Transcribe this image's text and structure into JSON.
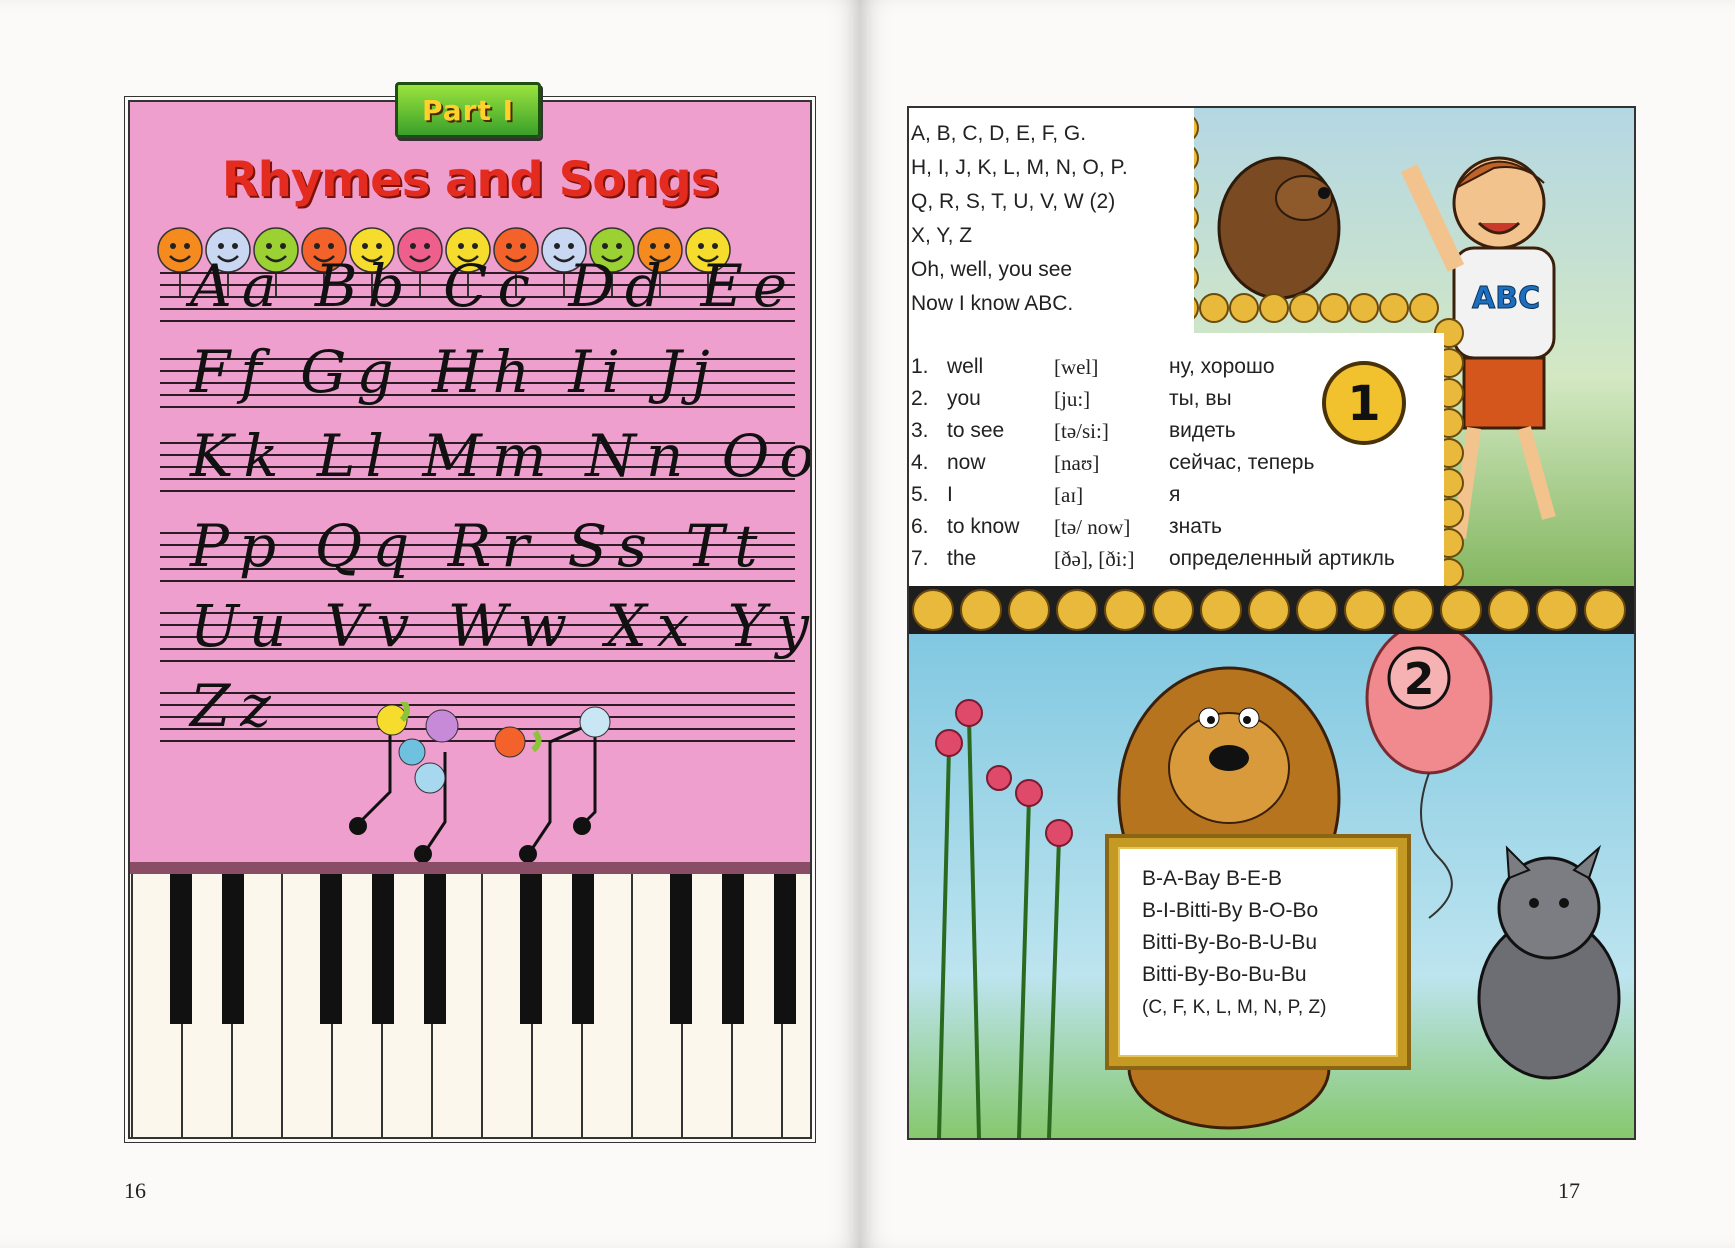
{
  "left_page": {
    "badge": "Part I",
    "title": "Rhymes and Songs",
    "cursive_rows": [
      "Aa Bb Cc Dd Ee",
      "Ff Gg Hh Ii Jj",
      "Kk Ll Mm Nn Oo",
      "Pp Qq Rr Ss Tt",
      "Uu Vv Ww Xx Yy",
      "Zz"
    ],
    "page_number": "16"
  },
  "right_page": {
    "alphabet_lines": [
      "A, B, C, D, E, F, G.",
      "H, I, J, K, L, M, N, O, P.",
      "Q, R, S, T, U, V, W (2)",
      "X, Y, Z",
      "Oh, well, you see",
      "Now I know ABC."
    ],
    "vocabulary": [
      {
        "num": "1.",
        "word": "well",
        "transcription": "[wel]",
        "russian": "ну, хорошо"
      },
      {
        "num": "2.",
        "word": "you",
        "transcription": "[ju:]",
        "russian": "ты, вы"
      },
      {
        "num": "3.",
        "word": "to see",
        "transcription": "[tə/si:]",
        "russian": "видеть"
      },
      {
        "num": "4.",
        "word": "now",
        "transcription": "[naʊ]",
        "russian": "сейчас, теперь"
      },
      {
        "num": "5.",
        "word": "I",
        "transcription": "[aɪ]",
        "russian": "я"
      },
      {
        "num": "6.",
        "word": "to know",
        "transcription": "[tə/ now]",
        "russian": "знать"
      },
      {
        "num": "7.",
        "word": "the",
        "transcription": "[ðə], [ði:]",
        "russian": "определенный артикль"
      }
    ],
    "badge_1": "1",
    "badge_2": "2",
    "shirt_text": "ABC",
    "sign_lines": [
      "B-A-Bay B-E-B",
      "B-I-Bitti-By B-O-Bo",
      "Bitti-By-Bo-B-U-Bu",
      "Bitti-By-Bo-Bu-Bu",
      "(C, F, K, L, M, N, P, Z)"
    ],
    "page_number": "17"
  },
  "colors": {
    "pink_page": "#ef9fcd",
    "title_red": "#e32b1f",
    "badge_green": "#3aa02a",
    "badge_text_yellow": "#ffd12a",
    "bead_gold": "#e8b93a",
    "sign_frame": "#c49a25",
    "balloon_pink": "#f08a8e"
  }
}
